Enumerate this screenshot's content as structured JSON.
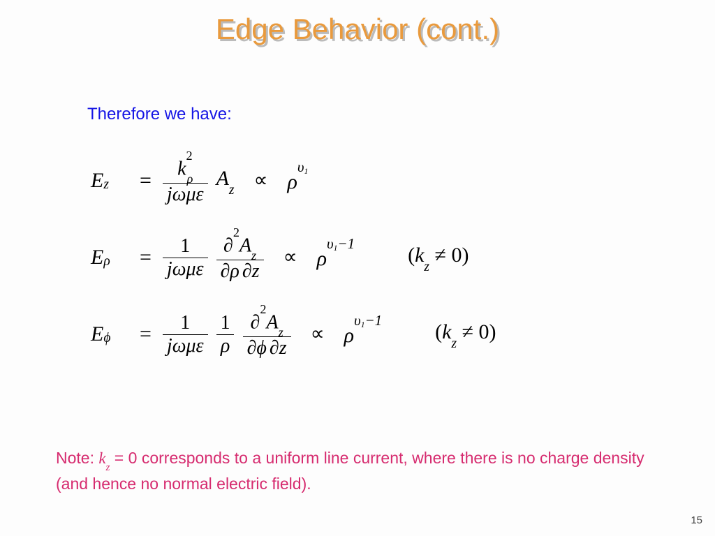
{
  "title": "Edge Behavior (cont.)",
  "intro": "Therefore we have:",
  "eq1": {
    "lhs_var": "E",
    "lhs_sub": "z",
    "frac_num_var": "k",
    "frac_num_sup": "2",
    "frac_num_sub": "ρ",
    "frac_den": "jωμε",
    "after_var": "A",
    "after_sub": "z",
    "prop_var": "ρ",
    "prop_exp_sym": "υ",
    "prop_exp_sub": "1"
  },
  "eq2": {
    "lhs_var": "E",
    "lhs_sub": "ρ",
    "frac1_num": "1",
    "frac1_den": "jωμε",
    "frac2_num_sym": "∂",
    "frac2_num_sup": "2",
    "frac2_num_var": "A",
    "frac2_num_sub": "z",
    "frac2_den_a": "∂ρ",
    "frac2_den_b": "∂z",
    "prop_var": "ρ",
    "prop_exp_sym": "υ",
    "prop_exp_sub": "1",
    "prop_exp_tail": "−1",
    "cond_open": "(",
    "cond_var": "k",
    "cond_sub": "z",
    "cond_rel": " ≠ 0)"
  },
  "eq3": {
    "lhs_var": "E",
    "lhs_sub": "ϕ",
    "frac1_num": "1",
    "frac1_den": "jωμε",
    "frac2_num": "1",
    "frac2_den": "ρ",
    "frac3_num_sym": "∂",
    "frac3_num_sup": "2",
    "frac3_num_var": "A",
    "frac3_num_sub": "z",
    "frac3_den_a": "∂ϕ",
    "frac3_den_b": "∂z",
    "prop_var": "ρ",
    "prop_exp_sym": "υ",
    "prop_exp_sub": "1",
    "prop_exp_tail": "−1",
    "cond_open": "(",
    "cond_var": "k",
    "cond_sub": "z",
    "cond_rel": " ≠ 0)"
  },
  "note": {
    "prefix": "Note: ",
    "math_var": "k",
    "math_sub": "z",
    "math_rel": " = 0",
    "rest": " corresponds to a uniform line current, where there is no charge density (and hence no normal electric field)."
  },
  "page_number": "15",
  "symbols": {
    "equals": "=",
    "propto": "∝"
  }
}
